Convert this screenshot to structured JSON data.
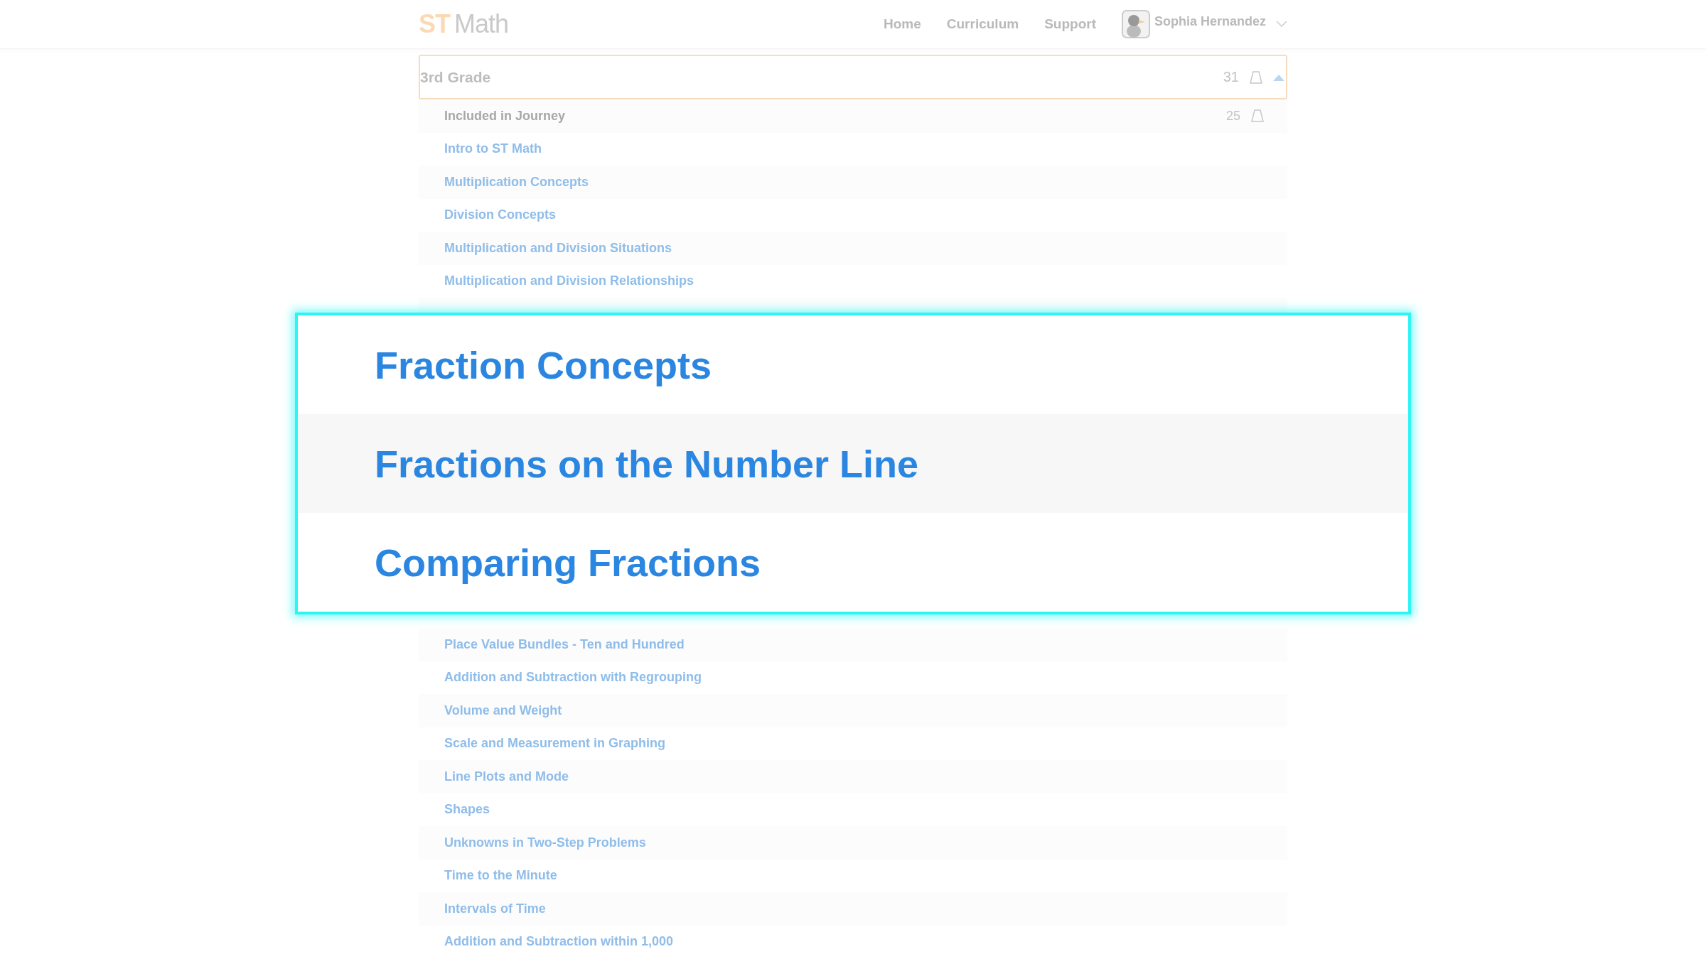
{
  "logo": {
    "brand": "ST",
    "name": "Math"
  },
  "nav": [
    "Home",
    "Curriculum",
    "Support"
  ],
  "user": {
    "name": "Sophia Hernandez"
  },
  "grade": {
    "title": "3rd Grade",
    "count": "31",
    "expanded": true
  },
  "journey": {
    "label": "Included in Journey",
    "count": "25"
  },
  "lessons_above": [
    "Intro to ST Math",
    "Multiplication Concepts",
    "Division Concepts",
    "Multiplication and Division Situations",
    "Multiplication and Division Relationships"
  ],
  "lessons_below": [
    "Place Value Bundles - Ten and Hundred",
    "Addition and Subtraction with Regrouping",
    "Volume and Weight",
    "Scale and Measurement in Graphing",
    "Line Plots and Mode",
    "Shapes",
    "Unknowns in Two-Step Problems",
    "Time to the Minute",
    "Intervals of Time",
    "Addition and Subtraction within 1,000"
  ],
  "callout": {
    "lessons": [
      "Fraction Concepts",
      "Fractions on the Number Line",
      "Comparing Fractions"
    ]
  }
}
